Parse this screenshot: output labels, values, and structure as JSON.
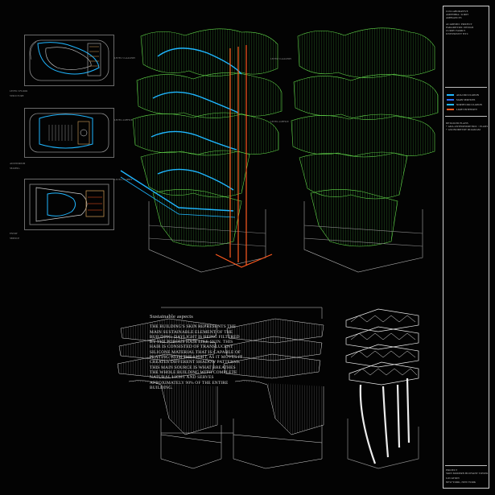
{
  "sheet": {
    "background": "#030303",
    "accent_green": "#62d94a",
    "accent_blue": "#1fb6ff",
    "accent_orange": "#ff5a1f",
    "structure_white": "#e8e8e8"
  },
  "sidebar": {
    "header_lines": [
      "COLLABORATIVE",
      "AMPHIBIA / KIRIT",
      "AMBIANCES",
      "ACADEMIC PROJECT",
      "PARAMETRIC DESIGN",
      "CURRY FAMILY",
      "UNIVERSITY NYC"
    ],
    "legend": [
      {
        "label": "ADA CIRCULATION",
        "color": "#1fb6ff"
      },
      {
        "label": "MAIN SERVICES",
        "color": "#2a6cff"
      },
      {
        "label": "NORTH CIRCULATION",
        "color": "#1fb6ff"
      },
      {
        "label": "LIGHT INTENSITY",
        "color": "#ff5a1f"
      }
    ],
    "drawing_title_lines": [
      "DETAILED PLANS",
      "+ ADA ANTHOPOMETRIC / PLANS",
      "+ AXONOMETRY DIAGRAM"
    ],
    "footer_lines": [
      "PROJECT",
      "SKIN MODERN BUOYANT TOWER",
      "LOCATION",
      "NEW YORK, NEW YORK"
    ]
  },
  "plans": [
    {
      "name": "plan-upper",
      "labels": [
        "LEVEL 5 FLOOR",
        "STRUCTURE",
        "RESTROOM"
      ]
    },
    {
      "name": "plan-middle",
      "labels": [
        "AUDITORIUM",
        "SEATING",
        "STAIR CORE"
      ]
    },
    {
      "name": "plan-lower",
      "labels": [
        "ENTRY",
        "RECEPTION",
        "SERVICE"
      ]
    }
  ],
  "callouts": {
    "left_tower": [
      "LEVEL 5 GALLERY",
      "LEVEL 4 OFFICE",
      "LEVEL 2 LOBBY"
    ],
    "right_tower": [
      "LEVEL 5 GALLERY",
      "LEVEL 4 OFFICE",
      "LEVEL 2 LOBBY"
    ]
  },
  "sustainable": {
    "title": "Sustainable aspects",
    "body": "THE BUILDING'S SKIN REPRESENTS THE MAIN SUSTAINABLE ELEMENT OF THE BUILDING. DAYLIGHT IS BEING FILTERED BY THE POROUS HAIR LIKE SKIN. THIS HAIR IS CONSISTED OF TRANSLUCENT SILICONE MATERIAL THAT IS CAPABLE OF PLAYING WITH THE LIGHT, AS IT MOVES IT CREATES DIFFERENT SHADOW PATTERNS. THIS MAIN SOURCE IS WHAT BREATHES THE WHOLE BUILDING WITH COMPLETE NATURAL LIGHT AND SERVES APROXIMATELY 90% OF THE ENTIRE BUILDING."
  }
}
